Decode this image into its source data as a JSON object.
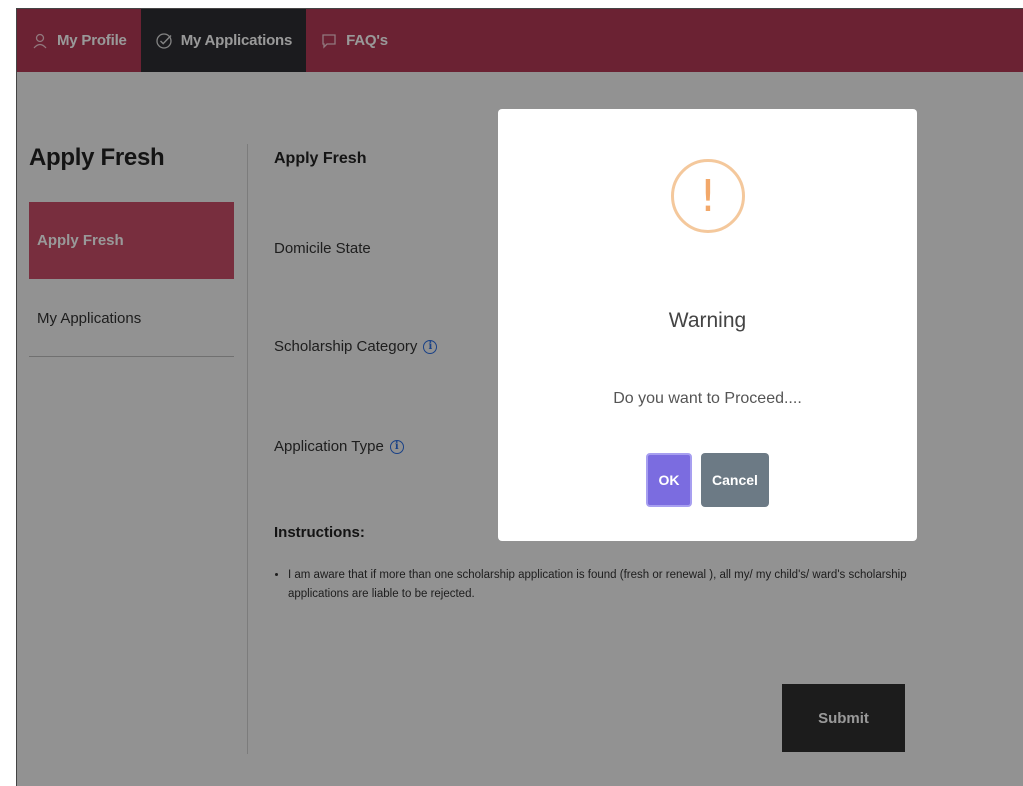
{
  "topnav": {
    "items": [
      {
        "label": "My Profile",
        "icon": "user-icon",
        "active": false
      },
      {
        "label": "My Applications",
        "icon": "check-circle-icon",
        "active": true
      },
      {
        "label": "FAQ's",
        "icon": "chat-icon",
        "active": false
      }
    ],
    "colors": {
      "bar": "#b23a55",
      "active": "#2e2e33"
    }
  },
  "sidebar": {
    "title": "Apply Fresh",
    "items": [
      {
        "label": "Apply Fresh",
        "active": true
      },
      {
        "label": "My Applications",
        "active": false
      }
    ]
  },
  "main": {
    "title": "Apply Fresh",
    "fields": [
      {
        "label": "Domicile State",
        "info": false
      },
      {
        "label": "Scholarship Category",
        "info": true
      },
      {
        "label": "Application Type",
        "info": true
      }
    ],
    "instructions_title": "Instructions:",
    "instructions": [
      "I am aware that if more than one scholarship application is found (fresh or renewal ), all my/ my child's/ ward's scholarship applications are liable to be rejected."
    ],
    "submit_label": "Submit"
  },
  "modal": {
    "icon": "warning-icon",
    "icon_glyph": "!",
    "title": "Warning",
    "text": "Do you want to Proceed....",
    "ok_label": "OK",
    "cancel_label": "Cancel"
  }
}
